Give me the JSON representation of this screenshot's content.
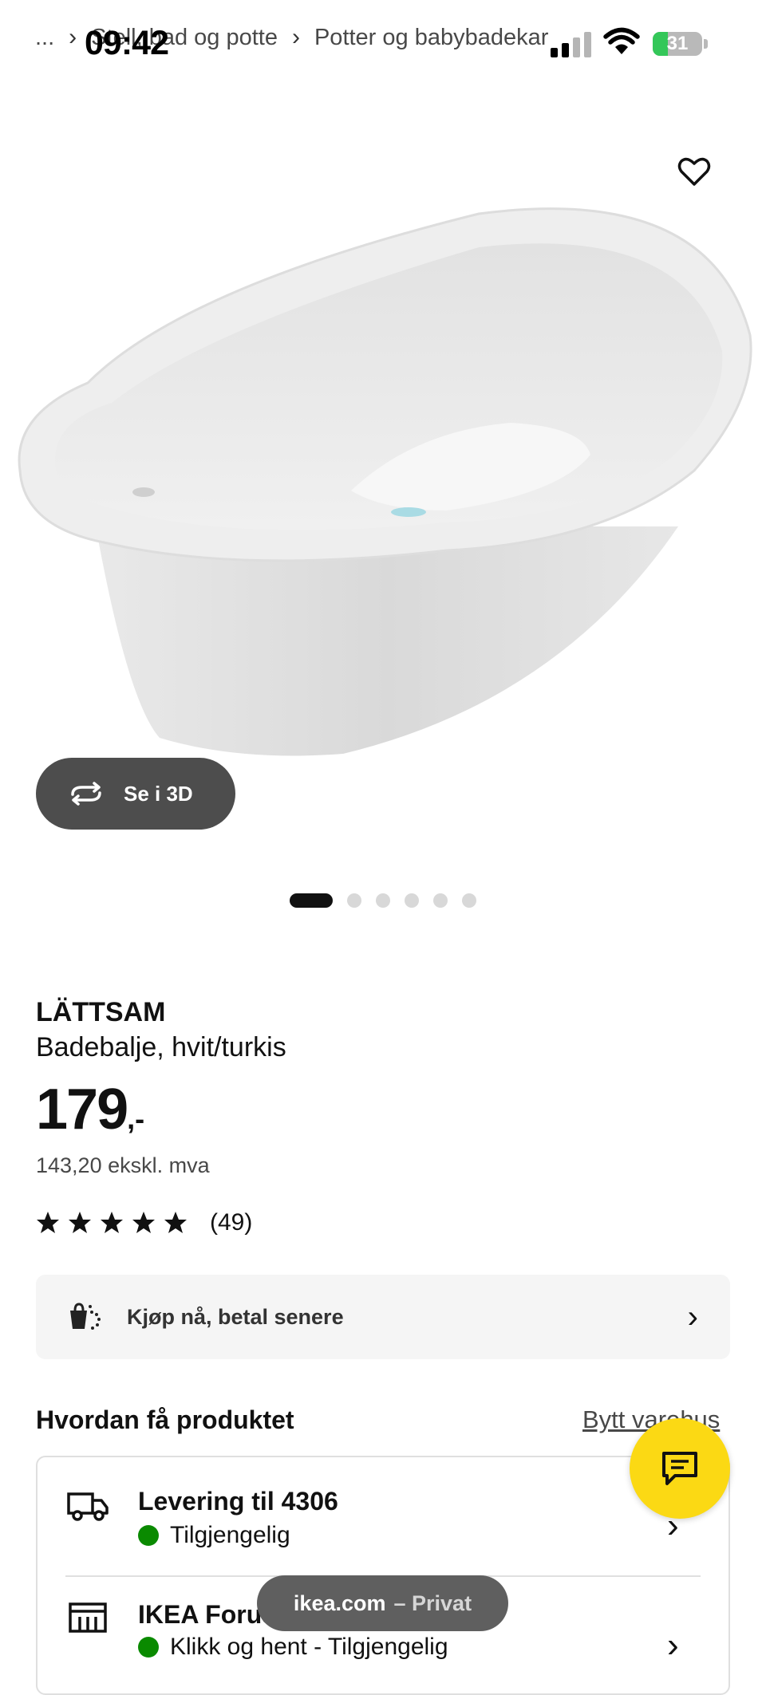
{
  "status_bar": {
    "time": "09:42",
    "battery_level": "31",
    "battery_color": "#34c759"
  },
  "breadcrumb": {
    "ellipsis": "...",
    "item_1": "Stell, bad og potte",
    "item_2": "Potter og babybadekar"
  },
  "gallery": {
    "view_3d_label": "Se i 3D",
    "page_count": 6,
    "active_page": 1
  },
  "product": {
    "brand": "LÄTTSAM",
    "description": "Badebalje, hvit/turkis",
    "price": "179",
    "price_suffix": ",-",
    "price_ex_vat": "143,20 ekskl. mva",
    "rating_stars": 5,
    "rating_count": "(49)"
  },
  "pay_later": {
    "label": "Kjøp nå, betal senere"
  },
  "availability": {
    "heading": "Hvordan få produktet",
    "change_store_link": "Bytt varehus",
    "delivery_title": "Levering til 4306",
    "delivery_status": "Tilgjengelig",
    "store_title": "IKEA Forus",
    "store_status": "Klikk og hent - Tilgjengelig",
    "status_color": "#0a8a00"
  },
  "browser": {
    "domain": "ikea.com",
    "mode": "– Privat"
  },
  "colors": {
    "accent_yellow": "#fbd914",
    "dark_button": "#4d4d4d"
  }
}
